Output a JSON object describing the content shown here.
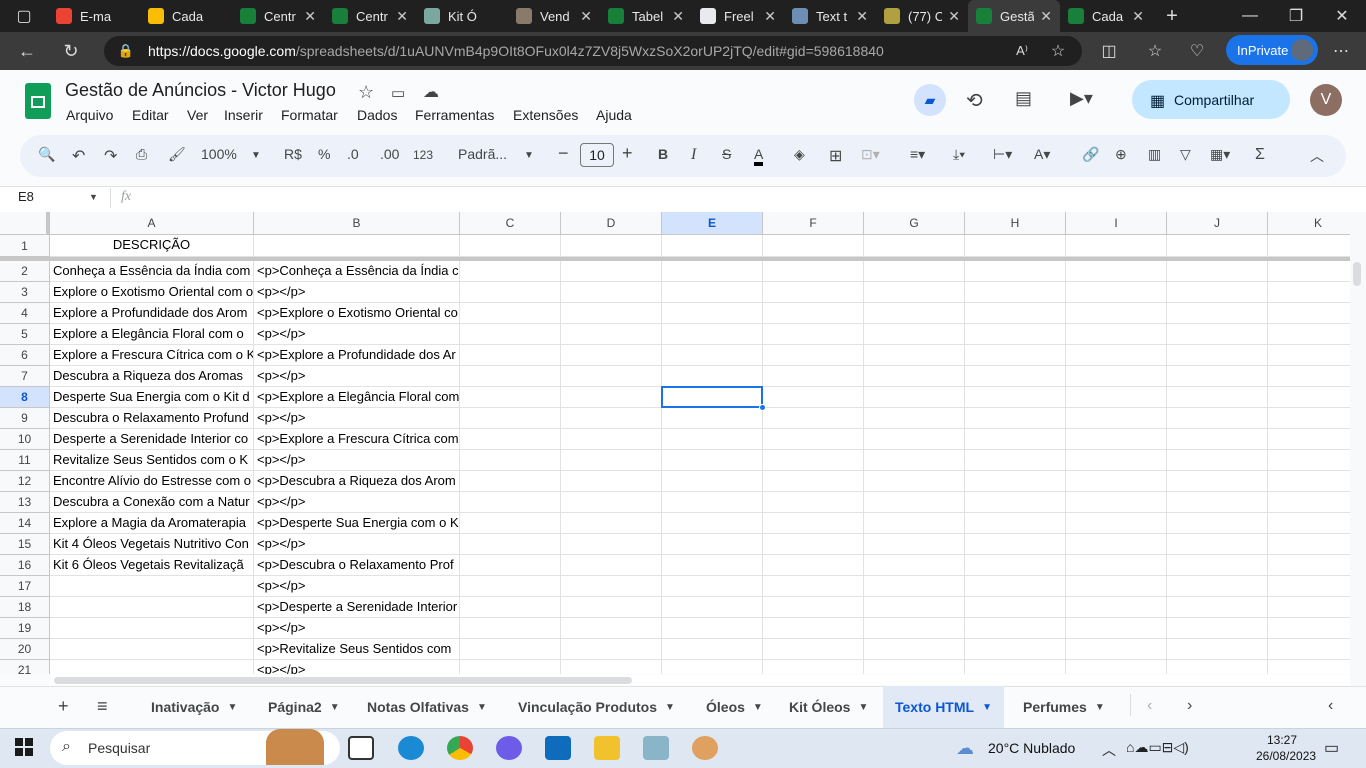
{
  "browser": {
    "tabs": [
      {
        "label": "E-ma",
        "color": "#ea4335"
      },
      {
        "label": "Cada",
        "color": "#fbbc04"
      },
      {
        "label": "Centr",
        "color": "#188038"
      },
      {
        "label": "Centr",
        "color": "#188038"
      },
      {
        "label": "Kit Ó",
        "color": "#7aa7a0"
      },
      {
        "label": "Vend",
        "color": "#8a7a6a"
      },
      {
        "label": "Tabel",
        "color": "#188038"
      },
      {
        "label": "Freel",
        "color": "#e8eaed"
      },
      {
        "label": "Text t",
        "color": "#6c8fb3"
      },
      {
        "label": "(77) C",
        "color": "#b0a040"
      },
      {
        "label": "Gestã",
        "color": "#188038"
      },
      {
        "label": "Cada",
        "color": "#188038"
      }
    ],
    "url_host": "https://docs.google.com",
    "url_path": "/spreadsheets/d/1uAUNVmB4p9OIt8OFux0l4z7ZV8j5WxzSoX2orUP2jTQ/edit#gid=598618840",
    "inprivate_label": "InPrivate"
  },
  "sheets": {
    "title": "Gestão de Anúncios - Victor Hugo",
    "menus": [
      "Arquivo",
      "Editar",
      "Ver",
      "Inserir",
      "Formatar",
      "Dados",
      "Ferramentas",
      "Extensões",
      "Ajuda"
    ],
    "share_label": "Compartilhar",
    "avatar_letter": "V",
    "toolbar": {
      "zoom": "100%",
      "currency": "R$",
      "percent": "%",
      "dec_less": ".0",
      "dec_more": ".00",
      "number_format": "123",
      "font": "Padrã...",
      "font_size": "10"
    },
    "name_box": "E8",
    "fx": "fx"
  },
  "grid": {
    "columns": [
      "A",
      "B",
      "C",
      "D",
      "E",
      "F",
      "G",
      "H",
      "I",
      "J",
      "K"
    ],
    "rows": [
      {
        "n": "1",
        "a": "DESCRIÇÃO",
        "b": ""
      },
      {
        "n": "2",
        "a": "Conheça a Essência da Índia com",
        "b": "<p>Conheça a Essência da Índia c"
      },
      {
        "n": "3",
        "a": "Explore o Exotismo Oriental com o",
        "b": "<p></p>"
      },
      {
        "n": "4",
        "a": "Explore a Profundidade dos Arom",
        "b": "<p>Explore o Exotismo Oriental co"
      },
      {
        "n": "5",
        "a": "Explore a Elegância Floral com o",
        "b": "<p></p>"
      },
      {
        "n": "6",
        "a": "Explore a Frescura Cítrica com o K",
        "b": "<p>Explore a Profundidade dos Ar"
      },
      {
        "n": "7",
        "a": "Descubra a Riqueza dos Aromas",
        "b": "<p></p>"
      },
      {
        "n": "8",
        "a": "Desperte Sua Energia com o Kit d",
        "b": "<p>Explore a Elegância Floral com"
      },
      {
        "n": "9",
        "a": "Descubra o Relaxamento Profund",
        "b": "<p></p>"
      },
      {
        "n": "10",
        "a": "Desperte a Serenidade Interior co",
        "b": "<p>Explore a Frescura Cítrica com"
      },
      {
        "n": "11",
        "a": "Revitalize Seus Sentidos com o K",
        "b": "<p></p>"
      },
      {
        "n": "12",
        "a": "Encontre Alívio do Estresse com o",
        "b": "<p>Descubra a Riqueza dos Arom"
      },
      {
        "n": "13",
        "a": "Descubra a Conexão com a Natur",
        "b": "<p></p>"
      },
      {
        "n": "14",
        "a": "Explore a Magia da Aromaterapia",
        "b": "<p>Desperte Sua Energia com o K"
      },
      {
        "n": "15",
        "a": "Kit 4 Óleos Vegetais Nutritivo Con",
        "b": "<p></p>"
      },
      {
        "n": "16",
        "a": "Kit 6 Óleos Vegetais Revitalizaçã",
        "b": "<p>Descubra o Relaxamento Prof"
      },
      {
        "n": "17",
        "a": "",
        "b": "<p></p>"
      },
      {
        "n": "18",
        "a": "",
        "b": "<p>Desperte a Serenidade Interior"
      },
      {
        "n": "19",
        "a": "",
        "b": "<p></p>"
      },
      {
        "n": "20",
        "a": "",
        "b": "<p>Revitalize Seus Sentidos com"
      },
      {
        "n": "21",
        "a": "",
        "b": "<p></p>"
      }
    ]
  },
  "sheet_tabs": [
    "Inativação",
    "Página2",
    "Notas Olfativas",
    "Vinculação Produtos",
    "Óleos",
    "Kit Óleos",
    "Texto HTML",
    "Perfumes"
  ],
  "active_sheet": "Texto HTML",
  "taskbar": {
    "search_label": "Pesquisar",
    "weather": "20°C  Nublado",
    "time": "13:27",
    "date": "26/08/2023"
  }
}
